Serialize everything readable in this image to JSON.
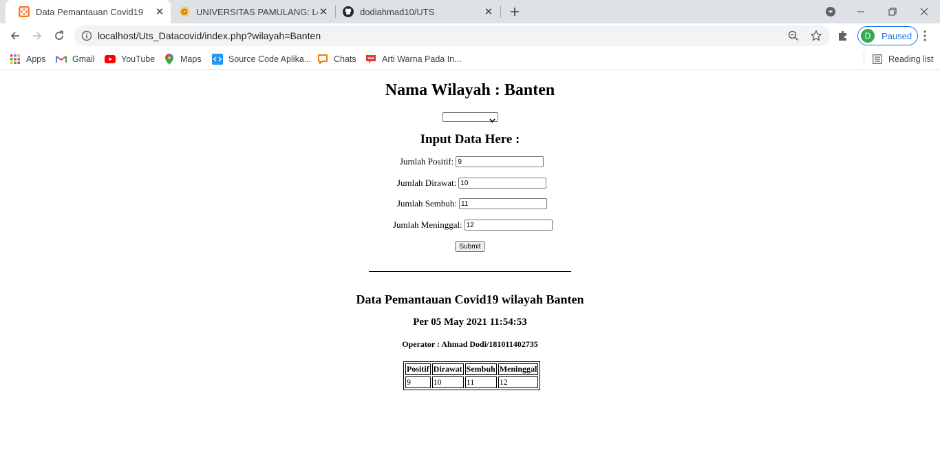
{
  "tabs": [
    {
      "title": "Data Pemantauan Covid19",
      "active": true,
      "icon": "xampp-icon"
    },
    {
      "title": "UNIVERSITAS PAMULANG: Log in",
      "active": false,
      "icon": "unpam-icon"
    },
    {
      "title": "dodiahmad10/UTS",
      "active": false,
      "icon": "github-icon"
    }
  ],
  "address_bar": {
    "url": "localhost/Uts_Datacovid/index.php?wilayah=Banten"
  },
  "profile": {
    "initial": "D",
    "status": "Paused"
  },
  "bookmarks": [
    {
      "label": "Apps",
      "icon": "apps-grid-icon"
    },
    {
      "label": "Gmail",
      "icon": "gmail-icon"
    },
    {
      "label": "YouTube",
      "icon": "youtube-icon"
    },
    {
      "label": "Maps",
      "icon": "maps-icon"
    },
    {
      "label": "Source Code Aplika...",
      "icon": "code-icon"
    },
    {
      "label": "Chats",
      "icon": "chat-icon"
    },
    {
      "label": "Arti Warna Pada In...",
      "icon": "bookmark-red-icon"
    }
  ],
  "reading_list": "Reading list",
  "page": {
    "title": "Nama Wilayah : Banten",
    "region_select": {
      "selected": ""
    },
    "form_heading": "Input Data Here :",
    "fields": {
      "positif": {
        "label": "Jumlah Positif:",
        "value": "9"
      },
      "dirawat": {
        "label": "Jumlah Dirawat:",
        "value": "10"
      },
      "sembuh": {
        "label": "Jumlah Sembuh:",
        "value": "11"
      },
      "meninggal": {
        "label": "Jumlah Meninggal:",
        "value": "12"
      }
    },
    "submit_label": "Submit",
    "report_title": "Data Pemantauan Covid19 wilayah Banten",
    "report_date": "Per 05 May 2021 11:54:53",
    "operator": "Operator : Ahmad Dodi/181011402735",
    "table": {
      "headers": [
        "Positif",
        "Dirawat",
        "Sembuh",
        "Meninggal"
      ],
      "rows": [
        [
          "9",
          "10",
          "11",
          "12"
        ]
      ]
    }
  },
  "colors": {
    "tabstrip": "#dee1e6",
    "accent": "#1a73e8",
    "avatar": "#34a853"
  }
}
